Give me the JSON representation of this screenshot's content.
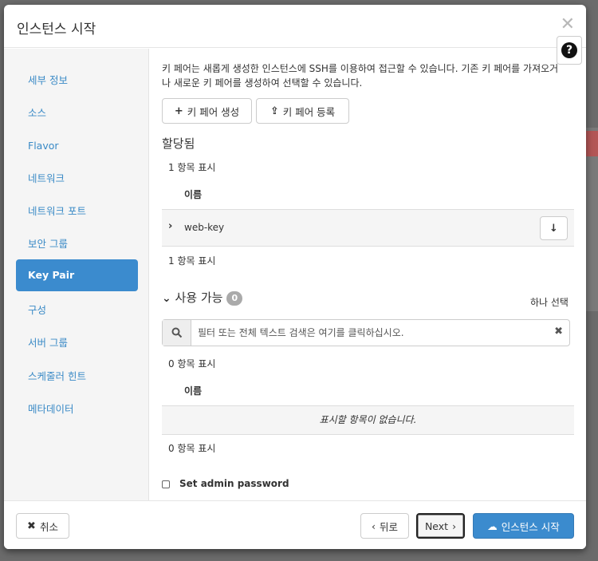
{
  "modal": {
    "title": "인스턴스 시작",
    "close": "✕",
    "help": "?"
  },
  "sidebar": {
    "items": [
      {
        "label": "세부 정보"
      },
      {
        "label": "소스"
      },
      {
        "label": "Flavor"
      },
      {
        "label": "네트워크"
      },
      {
        "label": "네트워크 포트"
      },
      {
        "label": "보안 그룹"
      },
      {
        "label": "Key Pair"
      },
      {
        "label": "구성"
      },
      {
        "label": "서버 그룹"
      },
      {
        "label": "스케줄러 힌트"
      },
      {
        "label": "메타데이터"
      }
    ],
    "active_index": 6
  },
  "content": {
    "help_text": "키 페어는 새롭게 생성한 인스턴스에 SSH를 이용하여 접근할 수 있습니다. 기존 키 페어를 가져오거나 새로운 키 페어를 생성하여 선택할 수 있습니다.",
    "create_keypair": "키 페어 생성",
    "import_keypair": "키 페어 등록",
    "allocated": {
      "title": "할당됨",
      "count_top": "1 항목 표시",
      "col_name": "이름",
      "rows": [
        {
          "name": "web-key"
        }
      ],
      "count_bottom": "1 항목 표시"
    },
    "available": {
      "title": "사용 가능",
      "badge": "0",
      "select_one": "하나 선택",
      "search_placeholder": "필터 또는 전체 텍스트 검색은 여기를 클릭하십시오.",
      "count_top": "0 항목 표시",
      "col_name": "이름",
      "empty": "표시할 항목이 없습니다.",
      "count_bottom": "0 항목 표시"
    },
    "admin_password": "Set admin password"
  },
  "footer": {
    "cancel": "취소",
    "back": "뒤로",
    "next": "Next",
    "launch": "인스턴스 시작"
  },
  "colors": {
    "accent": "#3b8bce",
    "link": "#3a8ac6"
  }
}
